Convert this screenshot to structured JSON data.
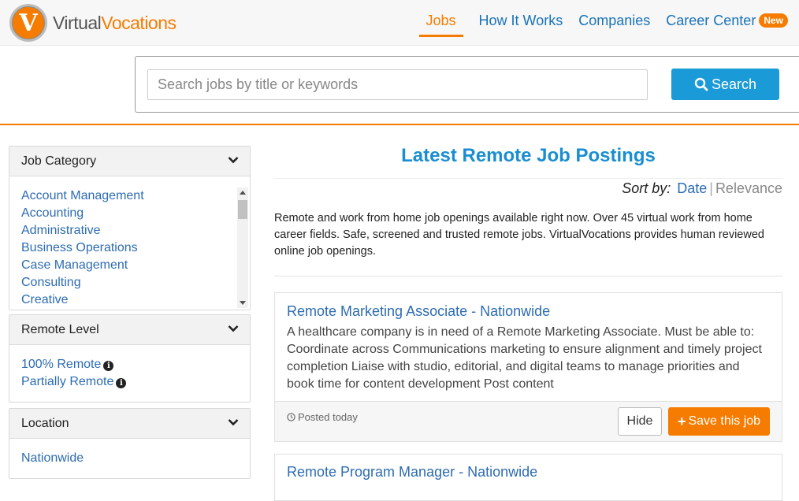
{
  "brand": {
    "logo_letter": "V",
    "name_part1": "Virtual",
    "name_part2": "Vocations"
  },
  "nav": {
    "items": [
      {
        "label": "Jobs"
      },
      {
        "label": "How It Works"
      },
      {
        "label": "Companies"
      },
      {
        "label": "Career Center",
        "badge": "New"
      }
    ]
  },
  "search": {
    "placeholder": "Search jobs by title or keywords",
    "value": "",
    "button_label": "Search"
  },
  "sidebar": {
    "job_category": {
      "title": "Job Category",
      "items": [
        "Account Management",
        "Accounting",
        "Administrative",
        "Business Operations",
        "Case Management",
        "Consulting",
        "Creative"
      ]
    },
    "remote_level": {
      "title": "Remote Level",
      "items": [
        "100% Remote",
        "Partially Remote"
      ]
    },
    "location": {
      "title": "Location",
      "items": [
        "Nationwide"
      ]
    }
  },
  "main": {
    "title": "Latest Remote Job Postings",
    "sort_label": "Sort by:",
    "sort_date": "Date",
    "sort_separator": "|",
    "sort_relevance": "Relevance",
    "intro": "Remote and work from home job openings available right now. Over 45 virtual work from home career fields. Safe, screened and trusted remote jobs. VirtualVocations provides human reviewed online job openings."
  },
  "jobs": [
    {
      "title": "Remote Marketing Associate - Nationwide",
      "description": "A healthcare company is in need of a Remote Marketing Associate. Must be able to: Coordinate across Communications marketing to ensure alignment and timely project completion Liaise with studio, editorial, and digital teams to manage priorities and book time for content development Post content",
      "posted": "Posted today",
      "hide_label": "Hide",
      "save_label": "Save this job"
    },
    {
      "title": "Remote Program Manager - Nationwide"
    }
  ],
  "colors": {
    "accent": "#f57c00",
    "link": "#2d6cb1",
    "button": "#1a9ad6"
  }
}
